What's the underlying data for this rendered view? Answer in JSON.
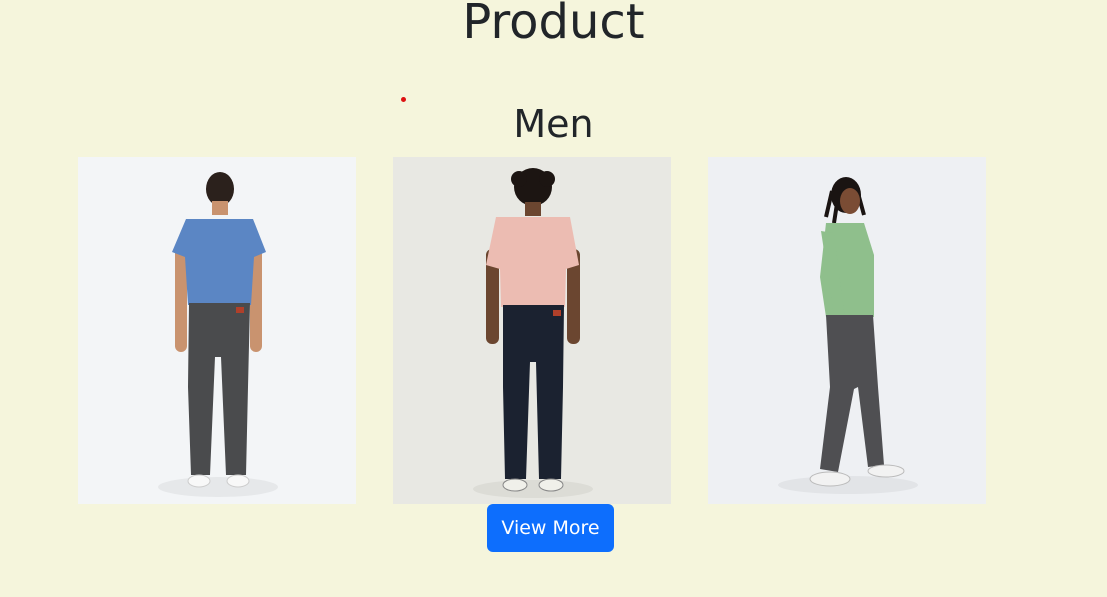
{
  "page": {
    "title": "Product"
  },
  "section": {
    "title": "Men"
  },
  "products": [
    {
      "image": "man-blue-tshirt-grey-jeans-back-view",
      "shirt_color": "#5b86c4",
      "pants_color": "#4a4b4d"
    },
    {
      "image": "man-pink-tshirt-dark-jeans-back-view",
      "shirt_color": "#ecbcb2",
      "pants_color": "#1b2230"
    },
    {
      "image": "man-green-sweater-grey-jeans-side-view",
      "shirt_color": "#8fbf8c",
      "pants_color": "#4f4f52"
    }
  ],
  "actions": {
    "view_more_label": "View More"
  },
  "colors": {
    "background": "#f5f5dc",
    "button": "#0d6efd",
    "button_text": "#ffffff",
    "heading": "#212529"
  }
}
